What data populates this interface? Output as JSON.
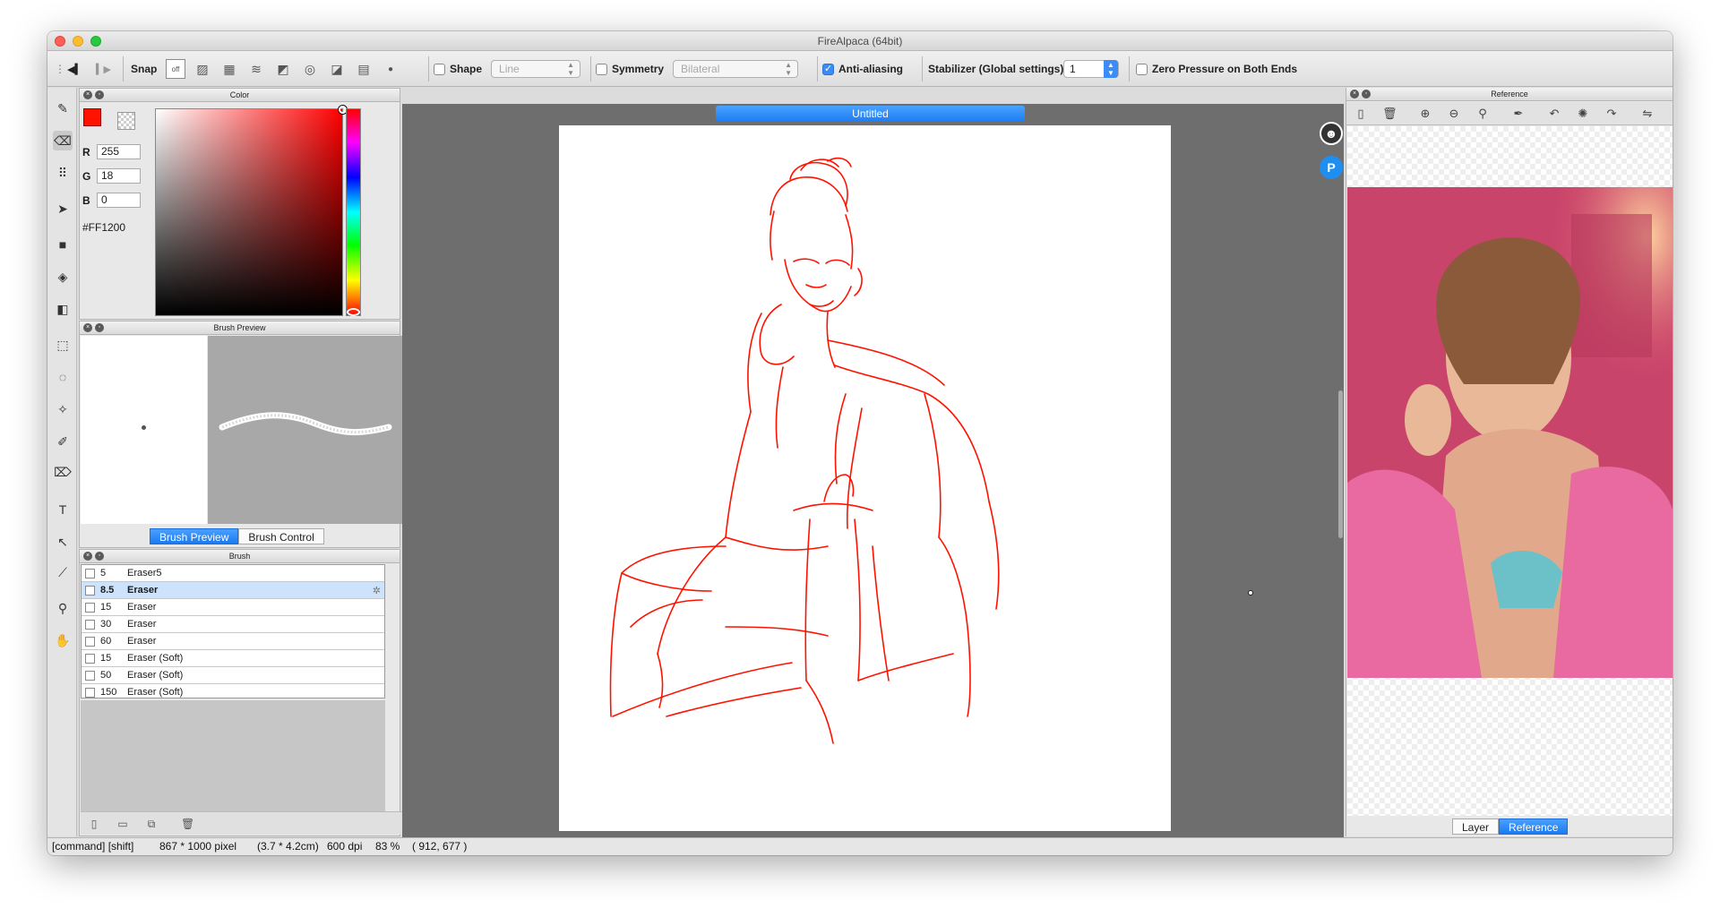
{
  "window": {
    "title": "FireAlpaca (64bit)"
  },
  "toolbar": {
    "snap_label": "Snap",
    "snap_off_label": "off",
    "shape_label": "Shape",
    "shape_value": "Line",
    "symmetry_label": "Symmetry",
    "symmetry_value": "Bilateral",
    "antialias_label": "Anti-aliasing",
    "stabilizer_label": "Stabilizer (Global settings)",
    "stabilizer_value": "1",
    "zero_pressure_label": "Zero Pressure on Both Ends"
  },
  "color_panel": {
    "title": "Color",
    "r_label": "R",
    "r_value": "255",
    "g_label": "G",
    "g_value": "18",
    "b_label": "B",
    "b_value": "0",
    "hex": "#FF1200",
    "fg_color": "#ff1200"
  },
  "brush_preview_panel": {
    "title": "Brush Preview",
    "tab_preview": "Brush Preview",
    "tab_control": "Brush Control"
  },
  "brush_panel": {
    "title": "Brush",
    "items": [
      {
        "size": "5",
        "name": "Eraser5"
      },
      {
        "size": "8.5",
        "name": "Eraser"
      },
      {
        "size": "15",
        "name": "Eraser"
      },
      {
        "size": "30",
        "name": "Eraser"
      },
      {
        "size": "60",
        "name": "Eraser"
      },
      {
        "size": "15",
        "name": "Eraser (Soft)"
      },
      {
        "size": "50",
        "name": "Eraser (Soft)"
      },
      {
        "size": "150",
        "name": "Eraser (Soft)"
      }
    ]
  },
  "canvas": {
    "doc_title": "Untitled",
    "stroke_color": "#ff1200"
  },
  "reference_panel": {
    "title": "Reference",
    "tab_layer": "Layer",
    "tab_reference": "Reference"
  },
  "status": {
    "keys": "[command] [shift]",
    "size": "867 * 1000 pixel",
    "size_cm": "(3.7 * 4.2cm)",
    "dpi": "600 dpi",
    "zoom": "83 %",
    "cursor": "( 912, 677 )"
  }
}
